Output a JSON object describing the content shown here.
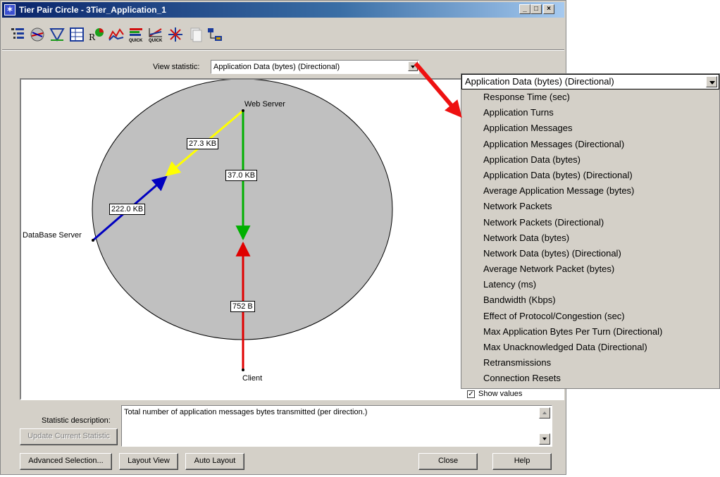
{
  "window": {
    "title": "Tier Pair Circle - 3Tier_Application_1"
  },
  "titlebar_buttons": {
    "minimize": "_",
    "maximize": "□",
    "close": "×"
  },
  "toolbar": {
    "icons": [
      "tree-view-icon",
      "network-icon",
      "triangle-chart-icon",
      "table-icon",
      "rx-icon",
      "line-graph-icon",
      "quick-bars-icon",
      "quick-chart-icon",
      "star-icon",
      "pages-icon",
      "topology-icon"
    ],
    "quick_label": "QUICK"
  },
  "view_statistic": {
    "label": "View statistic:",
    "selected": "Application Data (bytes) (Directional)"
  },
  "diagram": {
    "nodes": [
      "Web Server",
      "DataBase Server",
      "Client"
    ],
    "edges": [
      {
        "from": "Web Server",
        "to": "DataBase Server",
        "label": "27.3 KB",
        "color": "#ffff00"
      },
      {
        "from": "DataBase Server",
        "to": "Web Server",
        "label": "222.0 KB",
        "color": "#0000c0"
      },
      {
        "from": "Web Server",
        "to": "Client",
        "label": "37.0 KB",
        "color": "#00b000"
      },
      {
        "from": "Client",
        "to": "Web Server",
        "label": "752 B",
        "color": "#e00000"
      }
    ],
    "circle_fill": "#c0c0c0"
  },
  "dropdown": {
    "selected": "Application Data (bytes) (Directional)",
    "options": [
      "Response Time (sec)",
      "Application Turns",
      "Application Messages",
      "Application Messages (Directional)",
      "Application Data (bytes)",
      "Application Data (bytes) (Directional)",
      "Average Application Message (bytes)",
      "Network Packets",
      "Network Packets (Directional)",
      "Network Data (bytes)",
      "Network Data (bytes) (Directional)",
      "Average Network Packet (bytes)",
      "Latency (ms)",
      "Bandwidth (Kbps)",
      "Effect of Protocol/Congestion (sec)",
      "Max Application Bytes Per Turn (Directional)",
      "Max Unacknowledged Data (Directional)",
      "Retransmissions",
      "Connection Resets"
    ]
  },
  "show_values": {
    "label": "Show values",
    "checked": true
  },
  "description": {
    "label": "Statistic description:",
    "text": "Total number of application messages bytes transmitted (per direction.)"
  },
  "buttons": {
    "update": "Update Current Statistic",
    "advanced": "Advanced Selection...",
    "layout_view": "Layout View",
    "auto_layout": "Auto Layout",
    "close": "Close",
    "help": "Help"
  },
  "annotation": {
    "arrow_color": "#ee1111"
  }
}
